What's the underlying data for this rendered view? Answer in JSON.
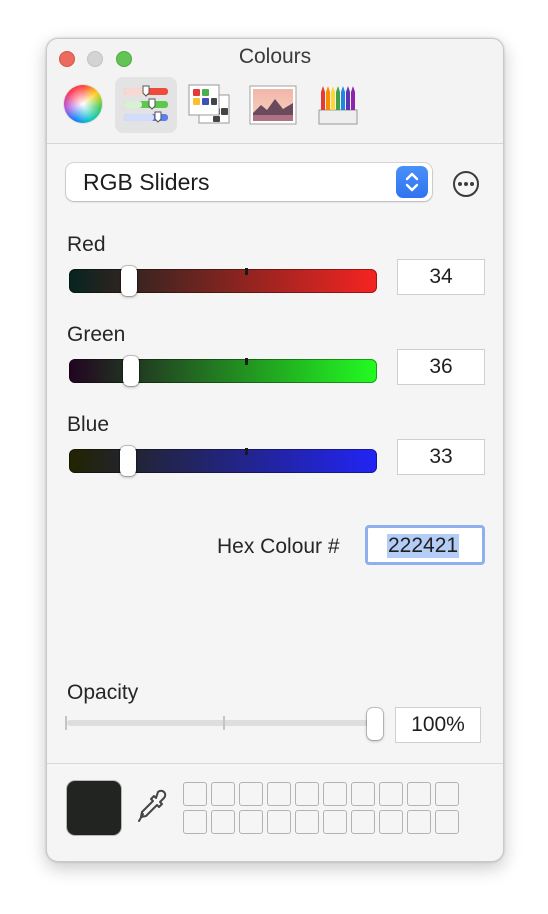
{
  "window": {
    "title": "Colours"
  },
  "toolbar": {
    "tabs": [
      {
        "name": "colour-wheel",
        "active": false
      },
      {
        "name": "colour-sliders",
        "active": true
      },
      {
        "name": "colour-palettes",
        "active": false
      },
      {
        "name": "image-palettes",
        "active": false
      },
      {
        "name": "pencils",
        "active": false
      }
    ]
  },
  "mode_popup": {
    "label": "RGB Sliders"
  },
  "sliders": {
    "red": {
      "label": "Red",
      "value": "34",
      "level": 34,
      "max": 255
    },
    "green": {
      "label": "Green",
      "value": "36",
      "level": 36,
      "max": 255
    },
    "blue": {
      "label": "Blue",
      "value": "33",
      "level": 33,
      "max": 255
    }
  },
  "hex": {
    "label": "Hex Colour #",
    "value": "222421"
  },
  "opacity": {
    "label": "Opacity",
    "value": "100%",
    "level": 1.0
  },
  "current_colour": "#222421",
  "colours": {
    "accent": "#3b82f6",
    "selection": "#b3cdf6"
  }
}
